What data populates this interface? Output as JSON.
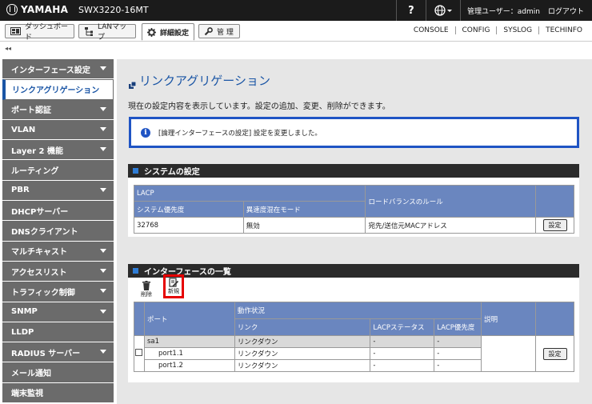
{
  "header": {
    "logo": "YAMAHA",
    "model": "SWX3220-16MT",
    "help": "?",
    "user_label": "管理ユーザー：admin",
    "logout": "ログアウト"
  },
  "tabs": [
    {
      "label": "ダッシュボード",
      "icon": "dashboard-icon"
    },
    {
      "label": "LANマップ",
      "icon": "lan-map-icon"
    },
    {
      "label": "詳細設定",
      "icon": "gear-icon",
      "active": true
    },
    {
      "label": "管 理",
      "icon": "wrench-icon"
    }
  ],
  "right_links": [
    "CONSOLE",
    "CONFIG",
    "SYSLOG",
    "TECHINFO"
  ],
  "collapse_symbol": "◂◂",
  "sidebar": [
    {
      "label": "インターフェース設定",
      "arrow": true
    },
    {
      "label": "リンクアグリゲーション",
      "selected": true
    },
    {
      "label": "ポート認証",
      "arrow": true
    },
    {
      "label": "VLAN",
      "arrow": true
    },
    {
      "label": "Layer 2 機能",
      "arrow": true
    },
    {
      "label": "ルーティング"
    },
    {
      "label": "PBR",
      "arrow": true
    },
    {
      "label": "DHCPサーバー"
    },
    {
      "label": "DNSクライアント"
    },
    {
      "label": "マルチキャスト",
      "arrow": true
    },
    {
      "label": "アクセスリスト",
      "arrow": true
    },
    {
      "label": "トラフィック制御",
      "arrow": true
    },
    {
      "label": "SNMP",
      "arrow": true
    },
    {
      "label": "LLDP"
    },
    {
      "label": "RADIUS サーバー",
      "arrow": true
    },
    {
      "label": "メール通知"
    },
    {
      "label": "端末監視"
    }
  ],
  "main": {
    "title": "リンクアグリゲーション",
    "description": "現在の設定内容を表示しています。設定の追加、変更、削除ができます。",
    "notice": "[論理インターフェースの設定] 設定を変更しました。"
  },
  "system_panel": {
    "title": "システムの設定",
    "lacp_header": "LACP",
    "col_priority": "システム優先度",
    "col_mixed": "異速度混在モード",
    "col_lb": "ロードバランスのルール",
    "row": {
      "priority": "32768",
      "mixed": "無効",
      "lb": "宛先/送信元MACアドレス"
    },
    "set_button": "設定"
  },
  "if_panel": {
    "title": "インターフェースの一覧",
    "delete_label": "削除",
    "new_label": "新規",
    "col_port": "ポート",
    "col_status": "動作状況",
    "col_link": "リンク",
    "col_lacp_status": "LACPステータス",
    "col_lacp_priority": "LACP優先度",
    "col_desc": "説明",
    "rows": [
      {
        "port": "sa1",
        "link": "リンクダウン",
        "lacp_status": "-",
        "lacp_priority": "-"
      },
      {
        "port": "port1.1",
        "link": "リンクダウン",
        "lacp_status": "-",
        "lacp_priority": "-"
      },
      {
        "port": "port1.2",
        "link": "リンクダウン",
        "lacp_status": "-",
        "lacp_priority": "-"
      }
    ],
    "set_button": "設定"
  },
  "colors": {
    "accent": "#1a55a5",
    "header_bg": "#1b1b1b",
    "table_header": "#6a86bf",
    "notice_border": "#1f54c4",
    "highlight": "#e60000"
  }
}
